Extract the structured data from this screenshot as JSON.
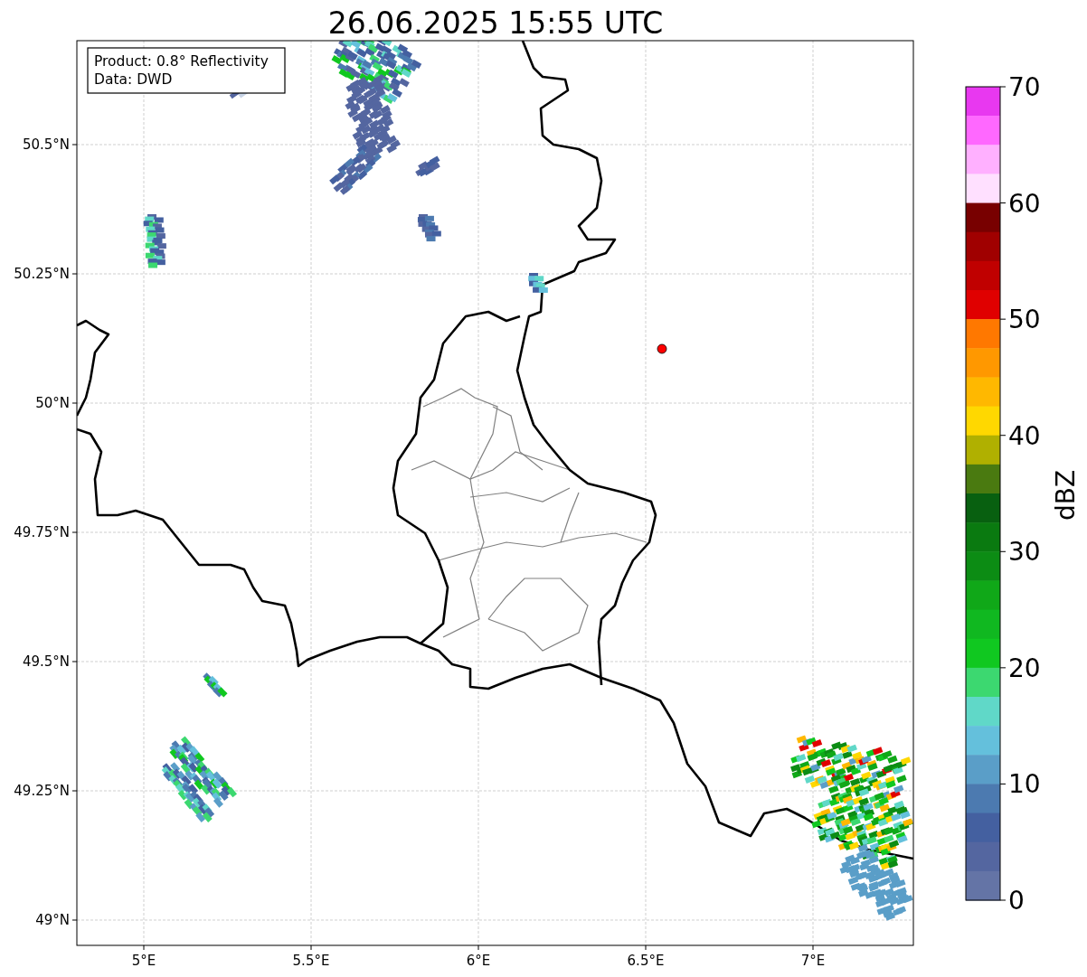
{
  "title": "26.06.2025 15:55 UTC",
  "info_box": {
    "lines": [
      "Product: 0.8° Reflectivity",
      "Data: DWD"
    ]
  },
  "map": {
    "x_ticks": [
      "5°E",
      "5.5°E",
      "6°E",
      "6.5°E",
      "7°E"
    ],
    "y_ticks": [
      "50.5°N",
      "50.25°N",
      "50°N",
      "49.75°N",
      "49.5°N",
      "49.25°N",
      "49°N"
    ]
  },
  "colorbar": {
    "label": "dBZ",
    "ticks": [
      "70",
      "60",
      "50",
      "40",
      "30",
      "20",
      "10",
      "0"
    ],
    "bins": [
      {
        "color": "#e838f0"
      },
      {
        "color": "#ff68ff"
      },
      {
        "color": "#ffb0ff"
      },
      {
        "color": "#ffe0ff"
      },
      {
        "color": "#780000"
      },
      {
        "color": "#a00000"
      },
      {
        "color": "#c00000"
      },
      {
        "color": "#e00000"
      },
      {
        "color": "#ff7800"
      },
      {
        "color": "#ff9800"
      },
      {
        "color": "#ffb800"
      },
      {
        "color": "#ffd800"
      },
      {
        "color": "#b0b000"
      },
      {
        "color": "#4a7a10"
      },
      {
        "color": "#086010"
      },
      {
        "color": "#0a7a10"
      },
      {
        "color": "#0c8c14"
      },
      {
        "color": "#10a818"
      },
      {
        "color": "#10b820"
      },
      {
        "color": "#10c820"
      },
      {
        "color": "#3cd870"
      },
      {
        "color": "#60d8c8"
      },
      {
        "color": "#64c0dc"
      },
      {
        "color": "#5a9ec8"
      },
      {
        "color": "#4c7ab0"
      },
      {
        "color": "#4460a0"
      },
      {
        "color": "#5466a0"
      },
      {
        "color": "#6474a6"
      }
    ]
  }
}
